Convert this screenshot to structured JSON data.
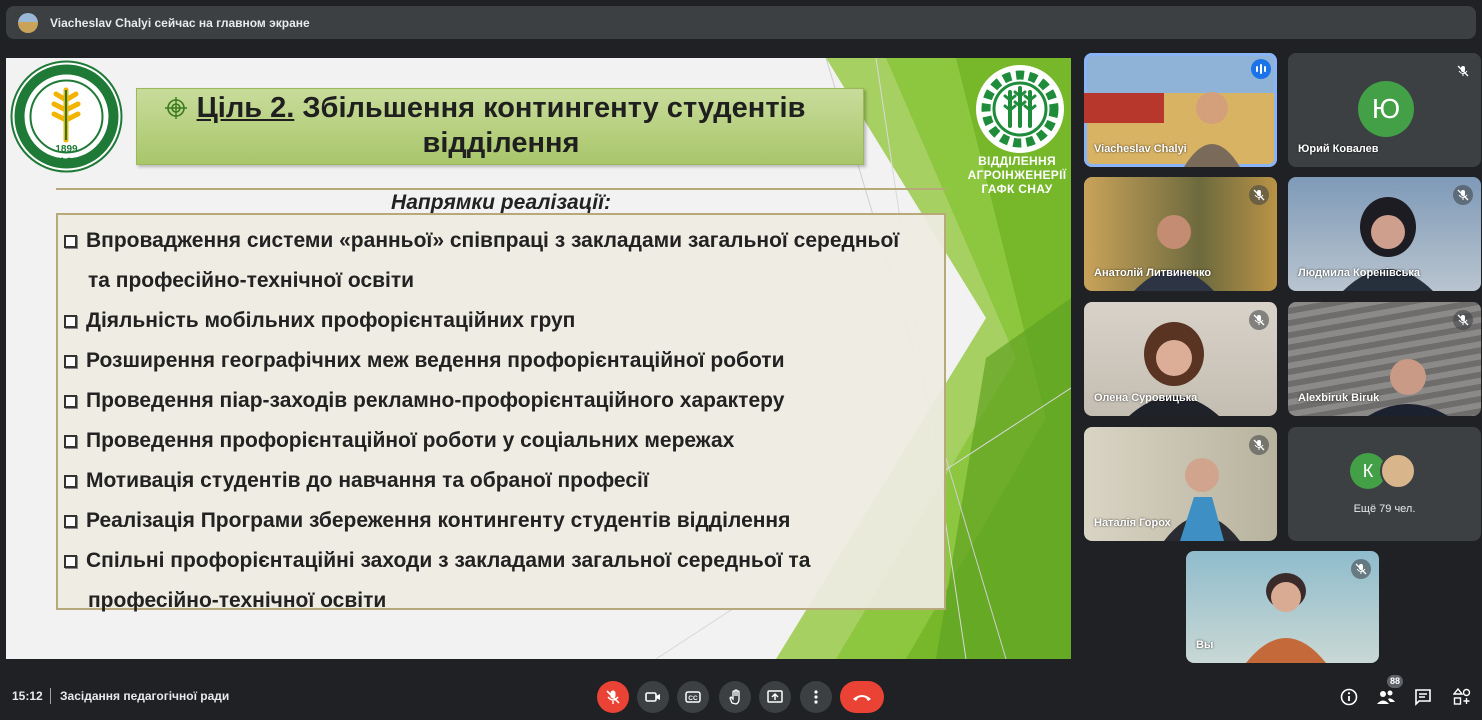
{
  "banner": {
    "text": "Viacheslav Chalyi сейчас на главном экране"
  },
  "slide": {
    "title_underlined": "Ціль 2.",
    "title_line1_rest": " Збільшення контингенту студентів",
    "title_line2": "відділення",
    "subheader": "Напрямки реалізації:",
    "items": [
      "Впровадження системи «ранньої» співпраці з закладами загальної середньої",
      "та професійно-технічної освіти",
      "Діяльність мобільних профорієнтаційних груп",
      "Розширення географічних меж ведення профорієнтаційної роботи",
      "Проведення піар-заходів рекламно-профорієнтаційного характеру",
      "Проведення профорієнтаційної роботи у соціальних мережах",
      "Мотивація студентів до навчання та обраної професії",
      "Реалізація Програми збереження контингенту студентів відділення",
      "Спільні профорієнтаційні заходи з закладами загальної середньої та",
      "професійно-технічної освіти"
    ],
    "dept_lines": [
      "ВІДДІЛЕННЯ",
      "АГРОІНЖЕНЕРІЇ",
      "ГАФК СНАУ"
    ],
    "logo_year": "1899",
    "logo_abbr": "ГАФК"
  },
  "participants": [
    {
      "name": "Viacheslav Chalyi"
    },
    {
      "name": "Юрий Ковалев",
      "initial": "Ю"
    },
    {
      "name": "Анатолій Литвиненко"
    },
    {
      "name": "Людмила Коренівська"
    },
    {
      "name": "Олена Суровицька"
    },
    {
      "name": "Alexbiruk Biruk"
    },
    {
      "name": "Наталія Горох"
    },
    {
      "name": "Вы"
    }
  ],
  "more": {
    "initial": "К",
    "label": "Ещё 79 чел."
  },
  "bottom": {
    "time": "15:12",
    "meeting_title": "Засідання педагогічної ради",
    "participants_count": "88"
  },
  "colors": {
    "accent_green": "#8dc63f",
    "mic_off_red": "#ea4335",
    "speaking_blue": "#1a73e8"
  }
}
